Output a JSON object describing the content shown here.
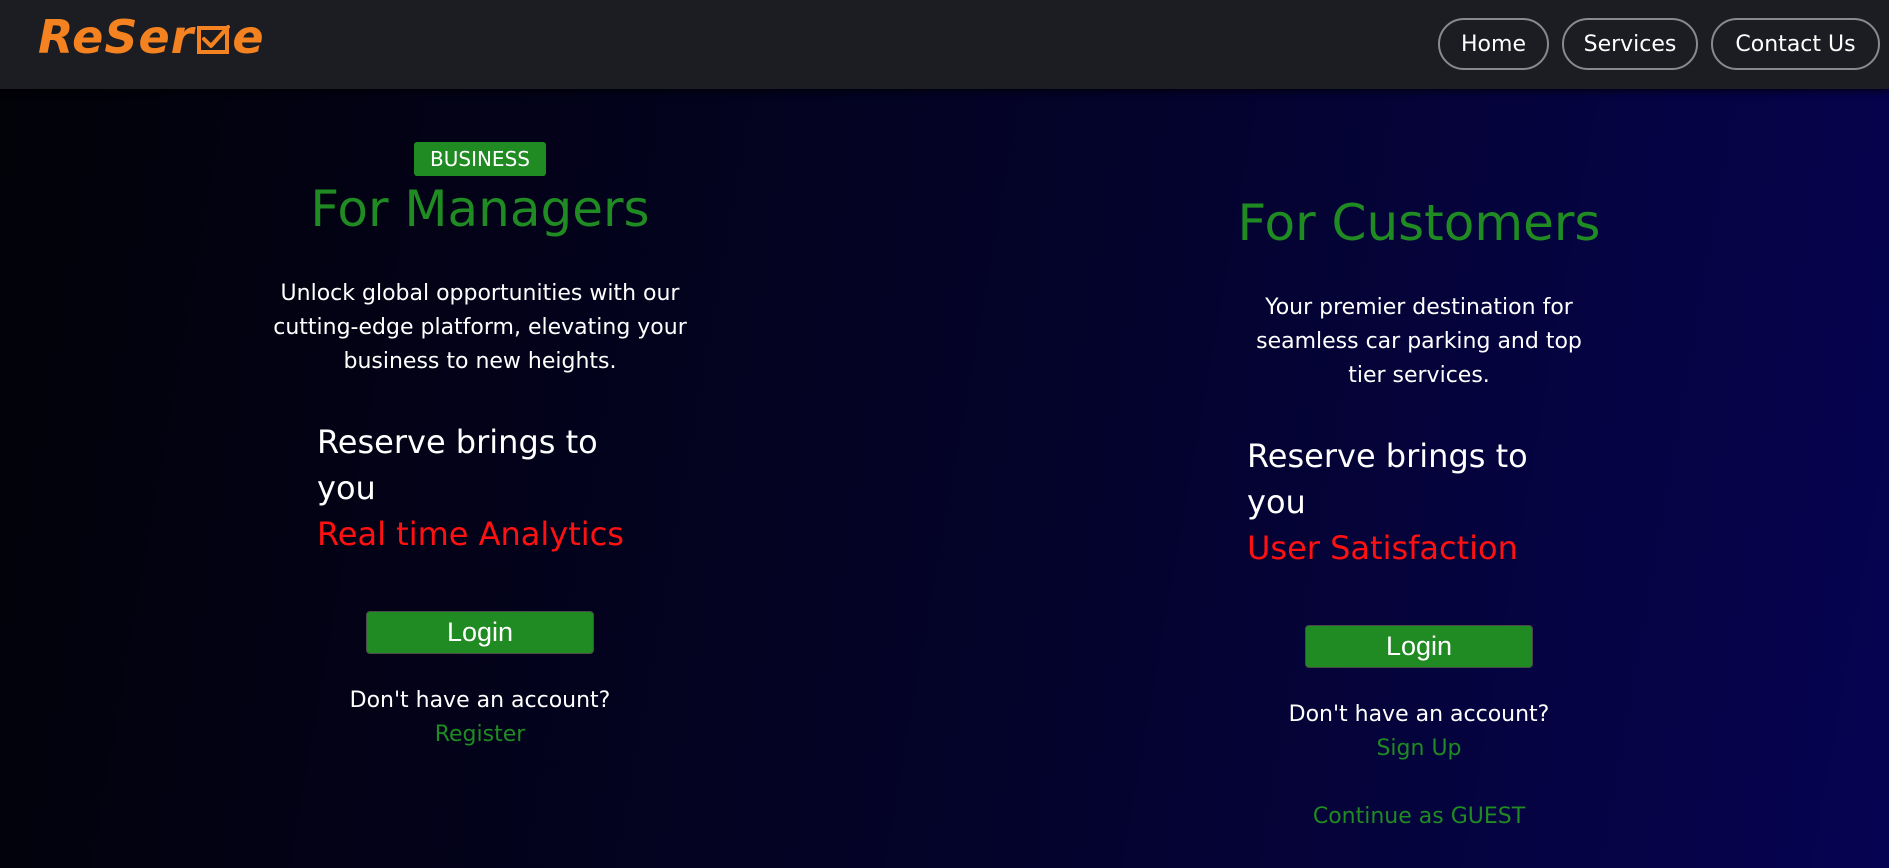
{
  "navbar": {
    "logo_text_before": "ReSer",
    "logo_text_after": "e",
    "logo_icon": "checkbox-icon",
    "brand_color": "#f58220",
    "links": [
      {
        "label": "Home"
      },
      {
        "label": "Services"
      },
      {
        "label": "Contact Us"
      }
    ]
  },
  "managers": {
    "badge": "BUSINESS",
    "title": "For Managers",
    "description": "Unlock global opportunities with our cutting-edge platform, elevating your business to new heights.",
    "brings": "Reserve brings to you",
    "highlight": "Real time Analytics",
    "login_label": "Login",
    "no_account": "Don't have an account?",
    "register_label": "Register"
  },
  "customers": {
    "title": "For Customers",
    "description": "Your premier destination for seamless car parking and top tier services.",
    "brings": "Reserve brings to you",
    "highlight": "User Satisfaction",
    "login_label": "Login",
    "no_account": "Don't have an account?",
    "signup_label": "Sign Up",
    "guest_label": "Continue as GUEST"
  },
  "colors": {
    "accent_green": "#1f8b22",
    "highlight_red": "#ff1111",
    "nav_bg": "#1c1d22"
  }
}
